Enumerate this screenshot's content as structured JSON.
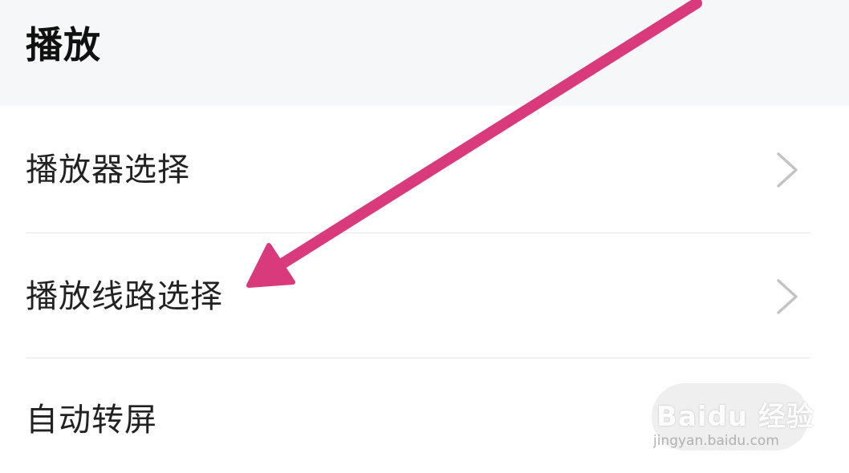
{
  "section": {
    "title": "播放"
  },
  "rows": [
    {
      "label": "播放器选择",
      "has_chevron": true
    },
    {
      "label": "播放线路选择",
      "has_chevron": true
    },
    {
      "label": "自动转屏",
      "has_chevron": false
    }
  ],
  "watermark": {
    "brand": "Baidu 经验",
    "url": "jingyan.baidu.com"
  },
  "annotation": {
    "type": "arrow",
    "color": "#d83a7c",
    "points_to": "播放线路选择"
  },
  "colors": {
    "header_bg": "#f6f7f9",
    "text": "#222222",
    "chevron": "#c4c4c4",
    "divider": "#e6e6e6"
  }
}
